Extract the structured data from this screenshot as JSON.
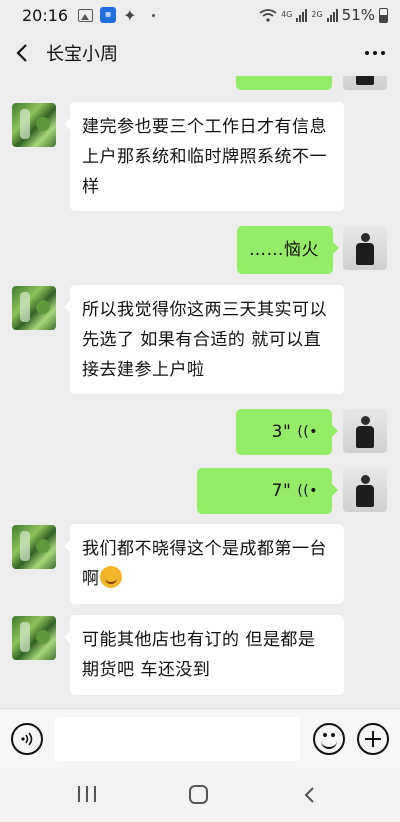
{
  "status_bar": {
    "time": "20:16",
    "network": "4G",
    "network2": "2G",
    "battery": "51%",
    "icons": [
      "image-icon",
      "app-icon",
      "running-icon",
      "dot-icon",
      "wifi-icon",
      "signal-icon",
      "battery-icon"
    ]
  },
  "header": {
    "title": "长宝小周",
    "back_icon": "back-arrow-icon",
    "more_icon": "more-dots-icon"
  },
  "messages": [
    {
      "direction": "in",
      "type": "text",
      "text": "建完参也要三个工作日才有信息 上户那系统和临时牌照系统不一样"
    },
    {
      "direction": "out",
      "type": "text",
      "text": "……恼火"
    },
    {
      "direction": "in",
      "type": "text",
      "text": "所以我觉得你这两三天其实可以先选了 如果有合适的 就可以直接去建参上户啦"
    },
    {
      "direction": "out",
      "type": "voice",
      "duration": "3\""
    },
    {
      "direction": "out",
      "type": "voice",
      "duration": "7\""
    },
    {
      "direction": "in",
      "type": "text",
      "text": "我们都不晓得这个是成都第一台啊",
      "emoji": "grimace-emoji"
    },
    {
      "direction": "in",
      "type": "text",
      "text": "可能其他店也有订的 但是都是期货吧 车还没到"
    }
  ],
  "input_bar": {
    "voice_icon": "voice-mode-icon",
    "placeholder": "",
    "emoji_icon": "emoji-icon",
    "plus_icon": "plus-icon"
  },
  "colors": {
    "background": "#ededed",
    "bubble_in": "#ffffff",
    "bubble_out": "#95ec69"
  }
}
